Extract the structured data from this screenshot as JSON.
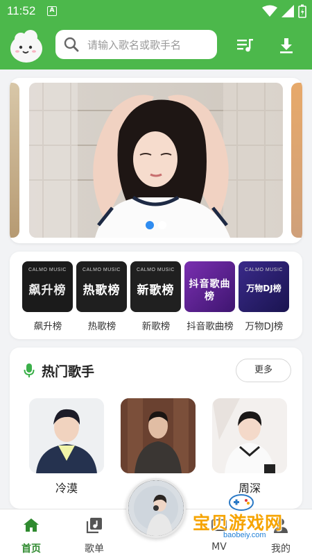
{
  "status_bar": {
    "time": "11:52",
    "badge": "A"
  },
  "header": {
    "search_placeholder": "请输入歌名或歌手名"
  },
  "banner": {
    "slide_count": 2,
    "active_slide": 1
  },
  "rankings": [
    {
      "label": "飙升榜",
      "cover_text": "飙升榜",
      "cover_brand": "CALMO MUSIC",
      "cover_color": "#1b1b1b"
    },
    {
      "label": "热歌榜",
      "cover_text": "热歌榜",
      "cover_brand": "CALMO MUSIC",
      "cover_color": "#1f1f1f"
    },
    {
      "label": "新歌榜",
      "cover_text": "新歌榜",
      "cover_brand": "CALMO MUSIC",
      "cover_color": "#202020"
    },
    {
      "label": "抖音歌曲榜",
      "cover_text": "抖音歌曲榜",
      "cover_brand": "",
      "cover_color": "#5a1f8a"
    },
    {
      "label": "万物DJ榜",
      "cover_text": "万物DJ榜",
      "cover_brand": "CALMO MUSIC",
      "cover_color": "#2a1e6e"
    }
  ],
  "hot_singers": {
    "title": "热门歌手",
    "more": "更多",
    "singers": [
      {
        "name": "冷漠"
      },
      {
        "name": ""
      },
      {
        "name": "周深"
      }
    ]
  },
  "bottom_nav": {
    "items": [
      {
        "label": "首页",
        "icon": "home-icon",
        "active": true
      },
      {
        "label": "歌单",
        "icon": "playlist-icon",
        "active": false
      },
      {
        "label": "MV",
        "icon": "mv-icon",
        "active": false
      },
      {
        "label": "我的",
        "icon": "profile-icon",
        "active": false
      }
    ]
  },
  "watermark": {
    "text": "宝贝游戏网",
    "url": "baobeiy.com"
  },
  "colors": {
    "brand_green": "#4cb84b",
    "active_dot": "#2f8cf0",
    "nav_active": "#2f8a2f"
  }
}
